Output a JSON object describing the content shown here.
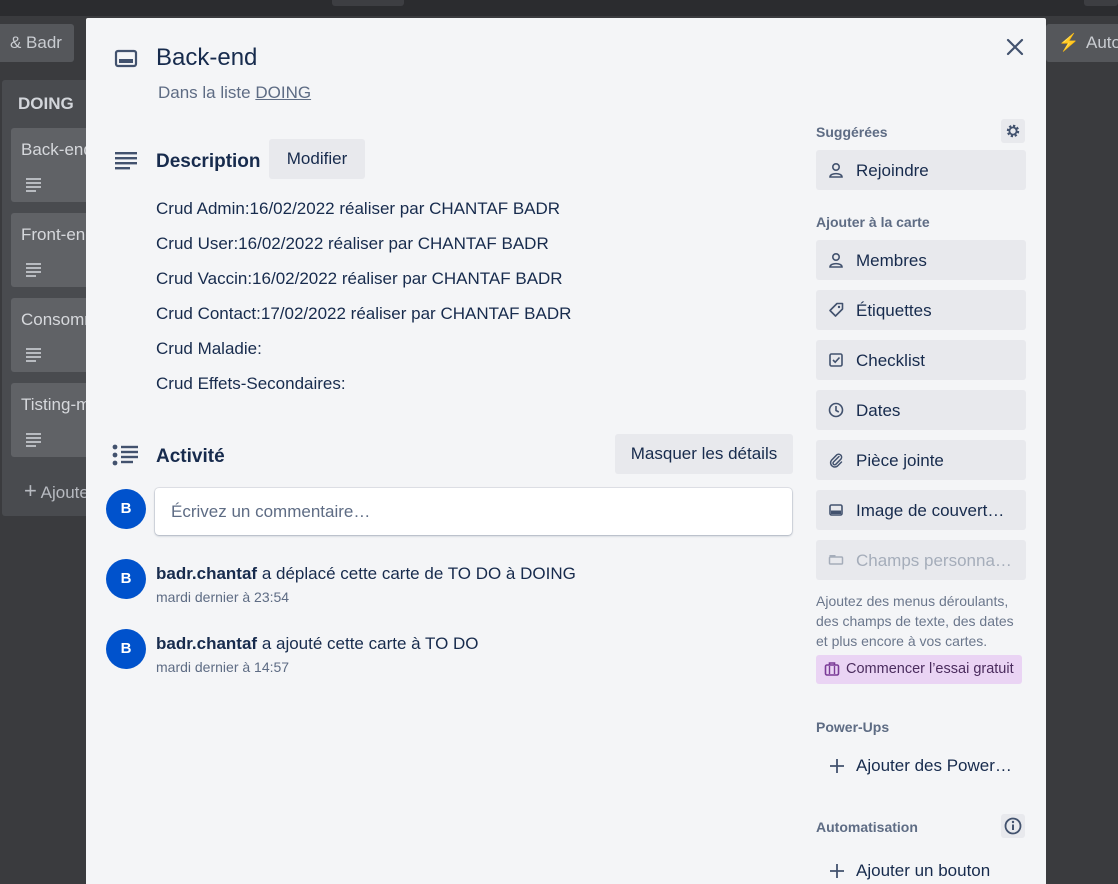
{
  "board": {
    "top_left_button": "& Badr",
    "top_right_button": "Auto",
    "list_title": "DOING",
    "cards": [
      "Back-end",
      "Front-end",
      "Consommation",
      "Tisting-m"
    ],
    "add_card_label": "Ajouter une carte"
  },
  "card": {
    "title": "Back-end",
    "list_prefix": "Dans la liste",
    "list_name": "DOING"
  },
  "description": {
    "title": "Description",
    "edit_label": "Modifier",
    "lines": [
      "Crud Admin:16/02/2022 réaliser par CHANTAF BADR",
      "Crud User:16/02/2022 réaliser par CHANTAF BADR",
      "Crud Vaccin:16/02/2022 réaliser par CHANTAF BADR",
      "Crud Contact:17/02/2022 réaliser par CHANTAF BADR",
      "Crud Maladie:",
      "Crud Effets-Secondaires:"
    ]
  },
  "activity": {
    "title": "Activité",
    "toggle_label": "Masquer les détails",
    "comment_placeholder": "Écrivez un commentaire…",
    "avatar_initial": "B",
    "items": [
      {
        "user": "badr.chantaf",
        "action": " a déplacé cette carte de TO DO à DOING",
        "time": "mardi dernier à 23:54"
      },
      {
        "user": "badr.chantaf",
        "action": " a ajouté cette carte à TO DO",
        "time": "mardi dernier à 14:57"
      }
    ]
  },
  "sidebar": {
    "suggested_title": "Suggérées",
    "join_label": "Rejoindre",
    "add_to_card_title": "Ajouter à la carte",
    "buttons": [
      "Membres",
      "Étiquettes",
      "Checklist",
      "Dates",
      "Pièce jointe",
      "Image de couvert…",
      "Champs personna…"
    ],
    "custom_fields_note": "Ajoutez des menus déroulants, des champs de texte, des dates et plus encore à vos cartes.",
    "trial_label": "Commencer l’essai gratuit",
    "powerups_title": "Power-Ups",
    "add_powerups_label": "Ajouter des Power…",
    "automation_title": "Automatisation",
    "add_button_label": "Ajouter un bouton"
  }
}
